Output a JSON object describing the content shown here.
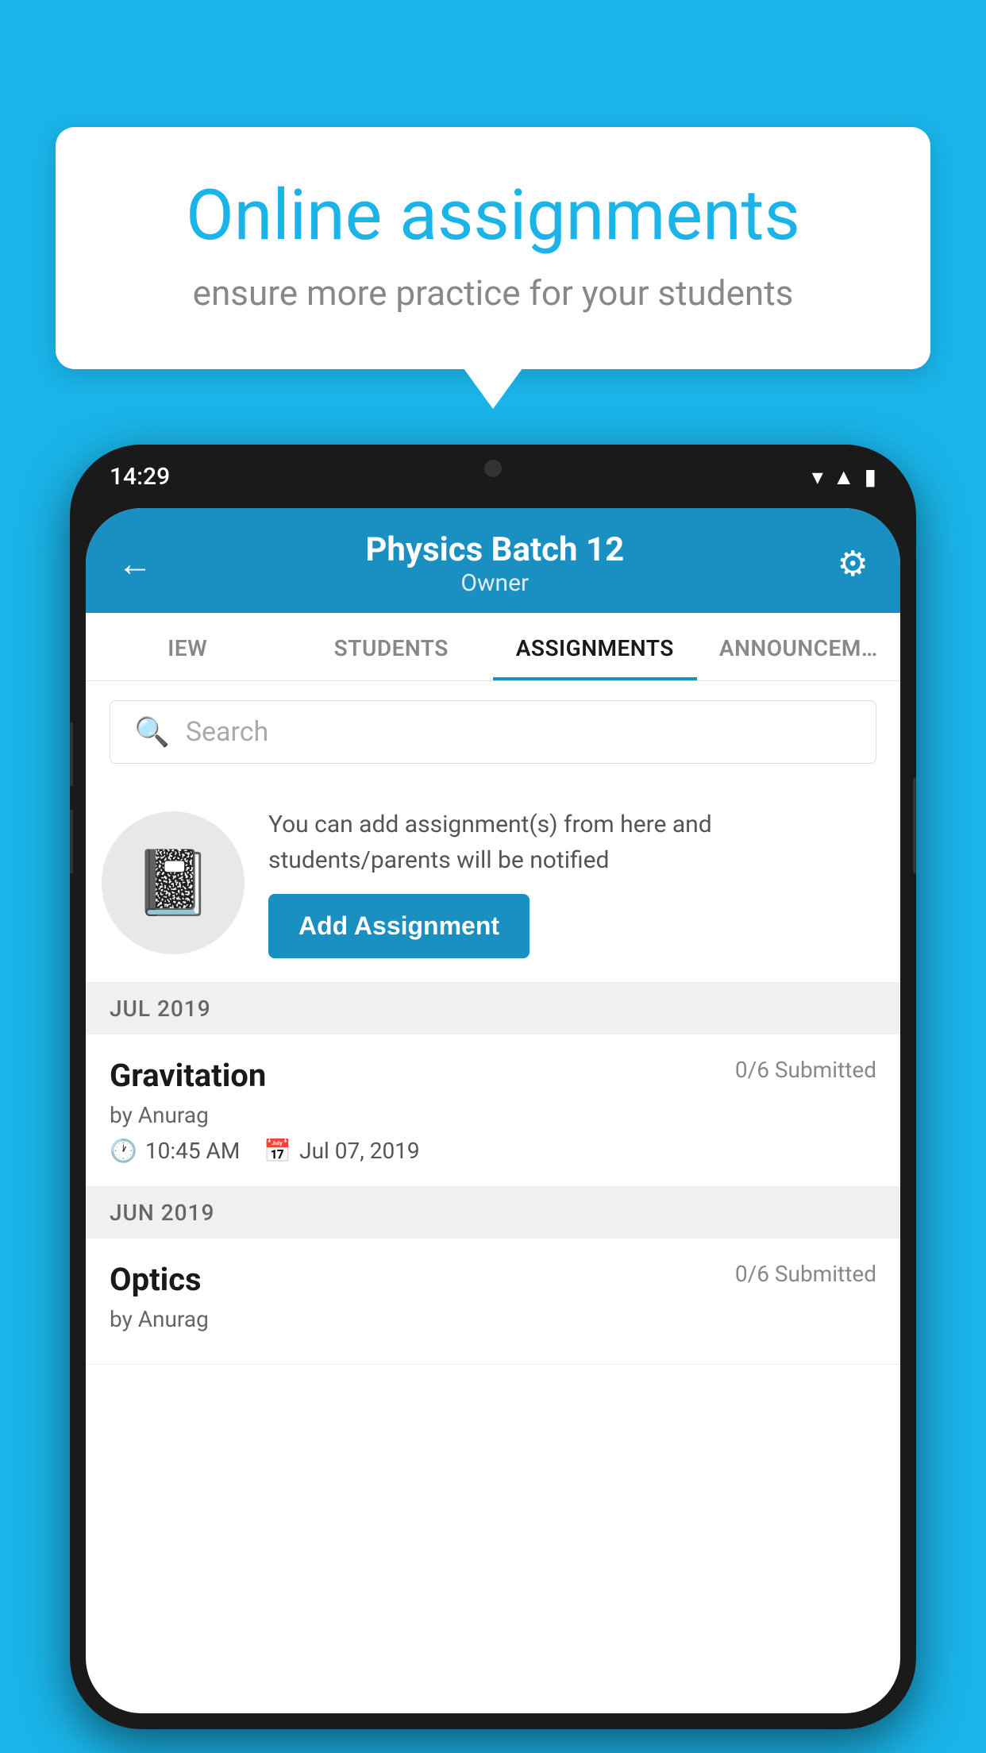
{
  "background_color": "#1ab4e8",
  "bubble": {
    "title": "Online assignments",
    "subtitle": "ensure more practice for your students"
  },
  "phone": {
    "status_time": "14:29",
    "header": {
      "title": "Physics Batch 12",
      "subtitle": "Owner",
      "back_icon": "←",
      "gear_icon": "⚙"
    },
    "tabs": [
      {
        "label": "IEW",
        "active": false
      },
      {
        "label": "STUDENTS",
        "active": false
      },
      {
        "label": "ASSIGNMENTS",
        "active": true
      },
      {
        "label": "ANNOUNCEM…",
        "active": false
      }
    ],
    "search": {
      "placeholder": "Search"
    },
    "promo": {
      "text": "You can add assignment(s) from here and students/parents will be notified",
      "button_label": "Add Assignment"
    },
    "sections": [
      {
        "month": "JUL 2019",
        "assignments": [
          {
            "name": "Gravitation",
            "submitted": "0/6 Submitted",
            "by": "by Anurag",
            "time": "10:45 AM",
            "date": "Jul 07, 2019"
          }
        ]
      },
      {
        "month": "JUN 2019",
        "assignments": [
          {
            "name": "Optics",
            "submitted": "0/6 Submitted",
            "by": "by Anurag",
            "time": "",
            "date": ""
          }
        ]
      }
    ]
  }
}
